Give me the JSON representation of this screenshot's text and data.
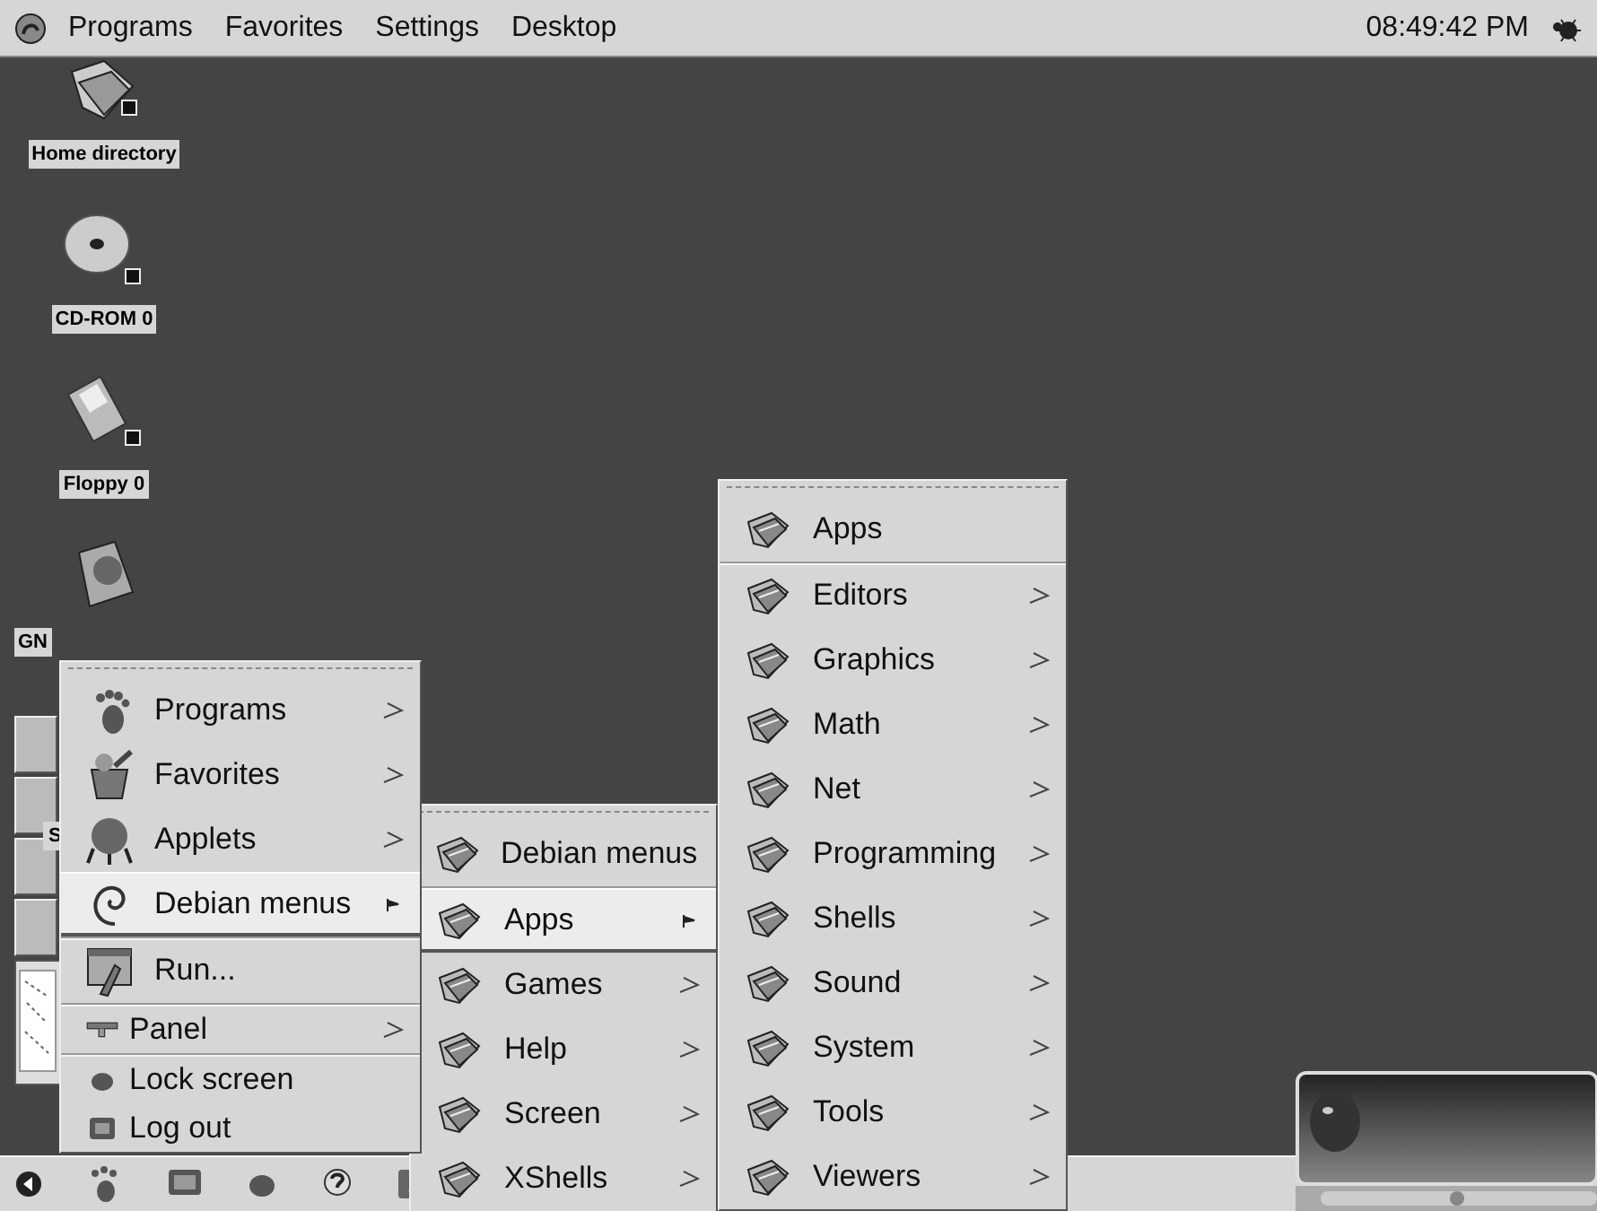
{
  "top_panel": {
    "menus": [
      "Programs",
      "Favorites",
      "Settings",
      "Desktop"
    ],
    "clock": "08:49:42 PM"
  },
  "desktop_icons": [
    {
      "label": "Home directory"
    },
    {
      "label": "CD-ROM 0"
    },
    {
      "label": "Floppy 0"
    },
    {
      "label": "GN"
    }
  ],
  "hidden_label": "S",
  "main_menu": {
    "sections": [
      {
        "items": [
          {
            "label": "Programs",
            "kind": "large",
            "submenu": true,
            "selected": false
          },
          {
            "label": "Favorites",
            "kind": "large",
            "submenu": true,
            "selected": false
          },
          {
            "label": "Applets",
            "kind": "large",
            "submenu": true,
            "selected": false
          },
          {
            "label": "Debian menus",
            "kind": "large",
            "submenu": true,
            "selected": true
          }
        ]
      },
      {
        "items": [
          {
            "label": "Run...",
            "kind": "large",
            "submenu": false,
            "selected": false
          }
        ]
      },
      {
        "items": [
          {
            "label": "Panel",
            "kind": "small",
            "submenu": true,
            "selected": false
          }
        ]
      },
      {
        "items": [
          {
            "label": "Lock screen",
            "kind": "small",
            "submenu": false,
            "selected": false
          },
          {
            "label": "Log out",
            "kind": "small",
            "submenu": false,
            "selected": false
          }
        ]
      }
    ]
  },
  "debian_menu": {
    "sections": [
      {
        "items": [
          {
            "label": "Debian menus",
            "submenu": false,
            "selected": false
          }
        ]
      },
      {
        "items": [
          {
            "label": "Apps",
            "submenu": true,
            "selected": true
          },
          {
            "label": "Games",
            "submenu": true,
            "selected": false
          },
          {
            "label": "Help",
            "submenu": true,
            "selected": false
          },
          {
            "label": "Screen",
            "submenu": true,
            "selected": false
          },
          {
            "label": "XShells",
            "submenu": true,
            "selected": false
          }
        ]
      }
    ]
  },
  "apps_menu": {
    "sections": [
      {
        "items": [
          {
            "label": "Apps",
            "submenu": false,
            "selected": false
          }
        ]
      },
      {
        "items": [
          {
            "label": "Editors",
            "submenu": true,
            "selected": false
          },
          {
            "label": "Graphics",
            "submenu": true,
            "selected": false
          },
          {
            "label": "Math",
            "submenu": true,
            "selected": false
          },
          {
            "label": "Net",
            "submenu": true,
            "selected": false
          },
          {
            "label": "Programming",
            "submenu": true,
            "selected": false
          },
          {
            "label": "Shells",
            "submenu": true,
            "selected": false
          },
          {
            "label": "Sound",
            "submenu": true,
            "selected": false
          },
          {
            "label": "System",
            "submenu": true,
            "selected": false
          },
          {
            "label": "Tools",
            "submenu": true,
            "selected": false
          },
          {
            "label": "Viewers",
            "submenu": true,
            "selected": false
          }
        ]
      }
    ]
  }
}
